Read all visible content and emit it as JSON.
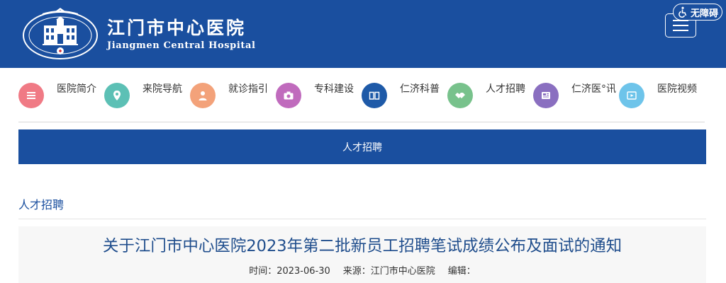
{
  "header": {
    "title": "江门市中心医院",
    "subtitle": "Jiangmen Central Hospital",
    "accessibility_label": "无障碍"
  },
  "nav": {
    "items": [
      {
        "label": "医院简介",
        "icon": "list-icon",
        "color": "#f07a85"
      },
      {
        "label": "来院导航",
        "icon": "location-pin-icon",
        "color": "#5cc0b5"
      },
      {
        "label": "就诊指引",
        "icon": "person-icon",
        "color": "#f3a27a"
      },
      {
        "label": "专科建设",
        "icon": "camera-icon",
        "color": "#c06bbd"
      },
      {
        "label": "仁济科普",
        "icon": "book-icon",
        "color": "#1e5aa8"
      },
      {
        "label": "人才招聘",
        "icon": "handshake-icon",
        "color": "#78c28c"
      },
      {
        "label": "仁济医°讯",
        "icon": "newspaper-icon",
        "color": "#8a6fc0"
      },
      {
        "label": "医院视频",
        "icon": "video-icon",
        "color": "#6ec4ea"
      }
    ]
  },
  "banner": {
    "label": "人才招聘"
  },
  "section": {
    "title": "人才招聘"
  },
  "article": {
    "title": "关于江门市中心医院2023年第二批新员工招聘笔试成绩公布及面试的通知",
    "time": "时间：2023-06-30",
    "source": "来源：江门市中心医院",
    "editor": "编辑："
  },
  "colors": {
    "brand": "#1a4f9f",
    "title_text": "#1f4d8c"
  }
}
